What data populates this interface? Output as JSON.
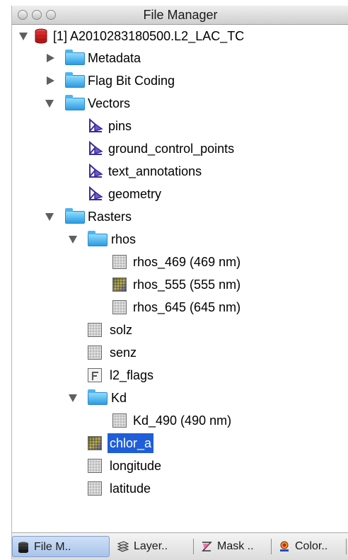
{
  "window": {
    "title": "File Manager"
  },
  "tree": {
    "product": "[1] A2010283180500.L2_LAC_TC",
    "metadata": "Metadata",
    "flag_bit_coding": "Flag Bit Coding",
    "vectors": "Vectors",
    "vector_items": [
      "pins",
      "ground_control_points",
      "text_annotations",
      "geometry"
    ],
    "rasters": "Rasters",
    "rhos": "rhos",
    "rhos_items": [
      "rhos_469 (469 nm)",
      "rhos_555 (555 nm)",
      "rhos_645 (645 nm)"
    ],
    "solz": "solz",
    "senz": "senz",
    "l2_flags": "l2_flags",
    "kd": "Kd",
    "kd_490": "Kd_490 (490 nm)",
    "chlor_a": "chlor_a",
    "longitude": "longitude",
    "latitude": "latitude",
    "selected_item": "chlor_a"
  },
  "tabs": [
    {
      "label": "File M..",
      "icon": "product-stack-icon",
      "active": true
    },
    {
      "label": "Layer..",
      "icon": "layers-icon",
      "active": false
    },
    {
      "label": "Mask ..",
      "icon": "mask-icon",
      "active": false
    },
    {
      "label": "Color..",
      "icon": "color-manipulation-icon",
      "active": false
    }
  ],
  "colors": {
    "selection": "#1f5ed8",
    "folder": "#2c9be0",
    "product_icon": "#d62b2b",
    "vector_icon": "#3a2d9a"
  }
}
